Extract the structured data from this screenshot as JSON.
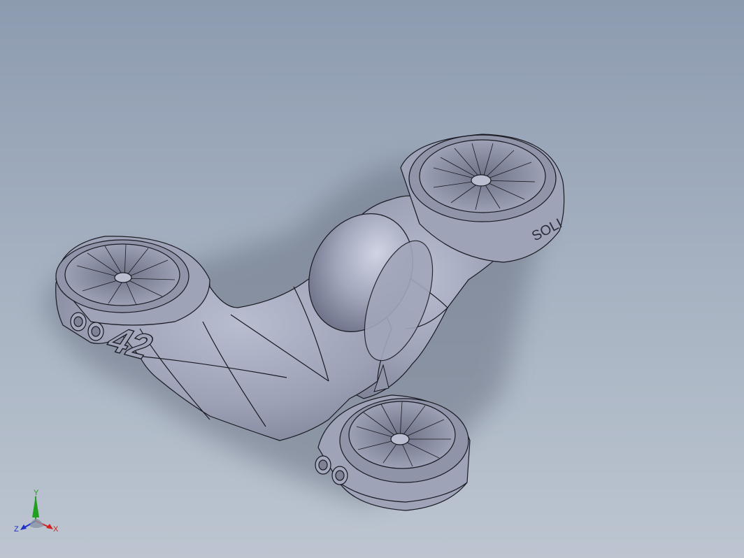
{
  "model": {
    "name_label": "42",
    "side_text": "SOLI"
  },
  "triad": {
    "y_label": "Y",
    "x_label": "X",
    "z_label": "Z",
    "y_color": "#1fa01f",
    "x_color": "#d42020",
    "z_color": "#2030c8"
  },
  "colors": {
    "background_top": "#8d9bb0",
    "background_bottom": "#bcc5d0",
    "body_fill": "#9ea3b8",
    "edge": "#1a1a22"
  }
}
